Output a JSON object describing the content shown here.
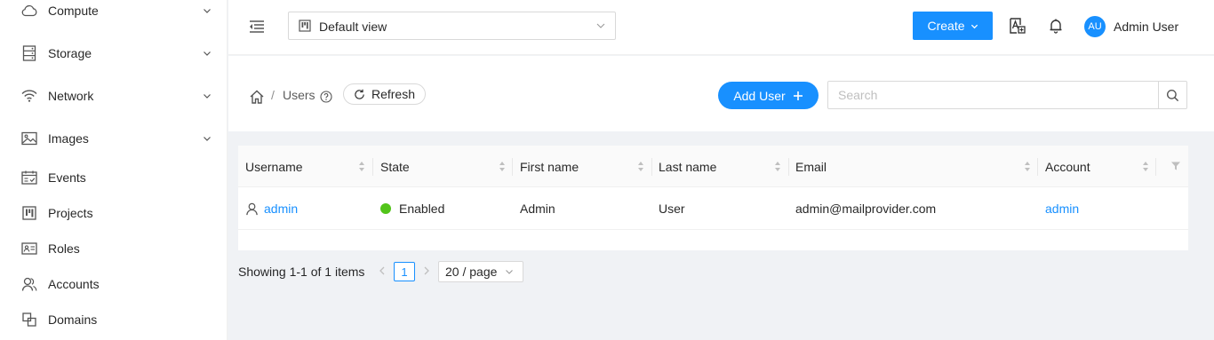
{
  "sidebar": {
    "items": [
      {
        "label": "Compute",
        "icon": "cloud-icon",
        "has_submenu": true
      },
      {
        "label": "Storage",
        "icon": "database-icon",
        "has_submenu": true
      },
      {
        "label": "Network",
        "icon": "wifi-icon",
        "has_submenu": true
      },
      {
        "label": "Images",
        "icon": "picture-icon",
        "has_submenu": true
      },
      {
        "label": "Events",
        "icon": "schedule-icon",
        "has_submenu": false
      },
      {
        "label": "Projects",
        "icon": "project-icon",
        "has_submenu": false
      },
      {
        "label": "Roles",
        "icon": "idcard-icon",
        "has_submenu": false
      },
      {
        "label": "Accounts",
        "icon": "team-icon",
        "has_submenu": false
      },
      {
        "label": "Domains",
        "icon": "block-icon",
        "has_submenu": false
      }
    ]
  },
  "header": {
    "view_select": {
      "value": "Default view"
    },
    "create_label": "Create",
    "user": {
      "initials": "AU",
      "name": "Admin User"
    }
  },
  "toolbar": {
    "breadcrumb": {
      "separator": "/",
      "current": "Users"
    },
    "refresh_label": "Refresh",
    "add_user_label": "Add User",
    "search": {
      "placeholder": "Search",
      "value": ""
    }
  },
  "table": {
    "columns": [
      "Username",
      "State",
      "First name",
      "Last name",
      "Email",
      "Account"
    ],
    "rows": [
      {
        "username": "admin",
        "state": "Enabled",
        "first_name": "Admin",
        "last_name": "User",
        "email": "admin@mailprovider.com",
        "account": "admin"
      }
    ]
  },
  "pagination": {
    "total_text": "Showing 1-1 of 1 items",
    "current_page": "1",
    "page_size": "20 / page"
  },
  "colors": {
    "primary": "#1890ff",
    "status_enabled": "#52c41a",
    "page_bg": "#f0f2f5"
  }
}
